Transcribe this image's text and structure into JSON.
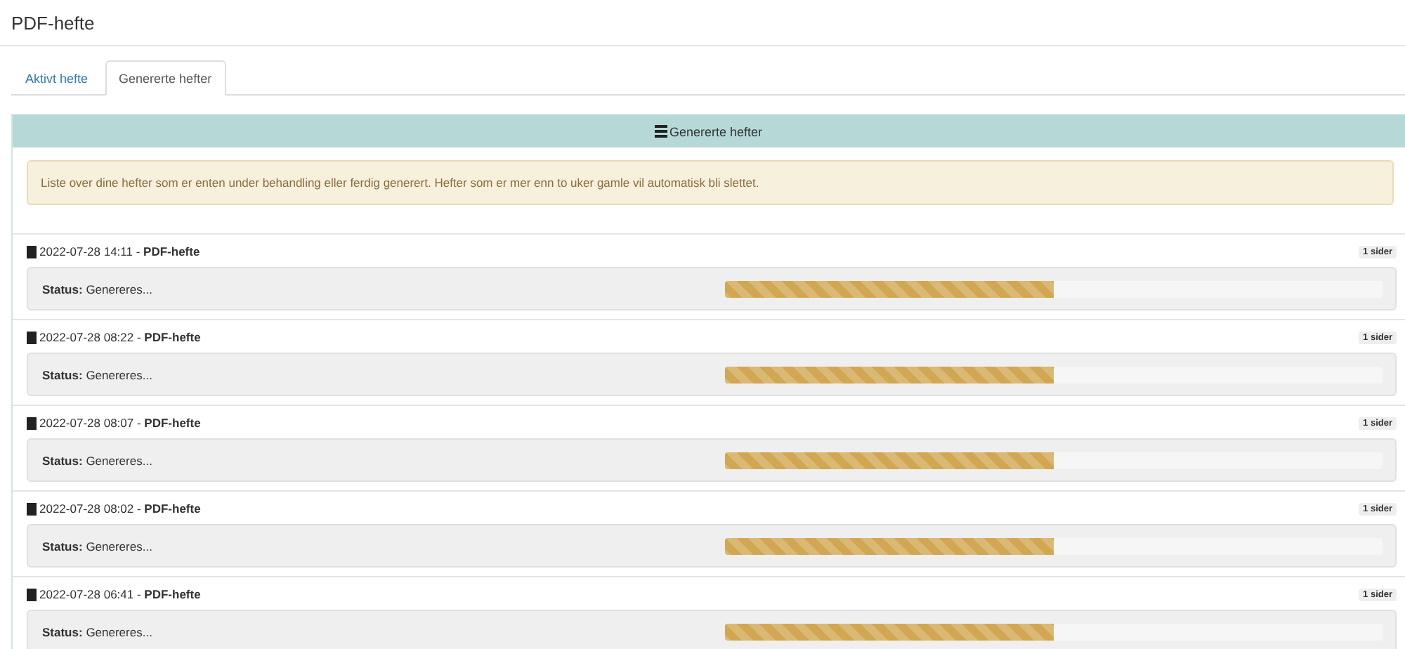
{
  "window": {
    "title": "PDF-hefte"
  },
  "tabs": [
    {
      "label": "Aktivt hefte",
      "selected": false
    },
    {
      "label": "Genererte hefter",
      "selected": true
    }
  ],
  "panel": {
    "heading": "Genererte hefter",
    "notice": "Liste over dine hefter som er enten under behandling eller ferdig generert. Hefter som er mer enn to uker gamle vil automatisk bli slettet."
  },
  "booklets": [
    {
      "title": "2022-07-28 14:11 - **PDF-hefte**",
      "pages": "1 sider",
      "status_label": "Status:",
      "status": "Genereres...",
      "level": 0.5
    },
    {
      "title": "2022-07-28 08:22 - **PDF-hefte**",
      "pages": "1 sider",
      "status_label": "Status:",
      "status": "Genereres...",
      "level": 0.5
    },
    {
      "title": "2022-07-28 08:07 - **PDF-hefte**",
      "pages": "1 sider",
      "status_label": "Status:",
      "status": "Genereres...",
      "level": 0.5
    },
    {
      "title": "2022-07-28 08:02 - **PDF-hefte**",
      "pages": "1 sider",
      "status_label": "Status:",
      "status": "Genereres...",
      "level": 0.5
    },
    {
      "title": "2022-07-28 06:41 - **PDF-hefte**",
      "pages": "1 sider",
      "status_label": "Status:",
      "status": "Genereres...",
      "level": 0.5
    }
  ]
}
